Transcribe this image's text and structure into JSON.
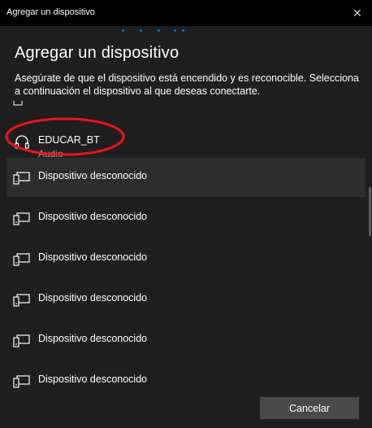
{
  "window": {
    "title": "Agregar un dispositivo",
    "close_glyph": "✕"
  },
  "header": {
    "title": "Agregar un dispositivo",
    "description": "Asegúrate de que el dispositivo está encendido y es reconocible. Selecciona a continuación el dispositivo al que deseas conectarte."
  },
  "devices": [
    {
      "name": "EDUCAR_BT",
      "subtitle": "Audio",
      "icon": "headphones-icon",
      "selected": false,
      "highlighted": true
    },
    {
      "name": "Dispositivo desconocido",
      "icon": "unknown-device-icon",
      "selected": true
    },
    {
      "name": "Dispositivo desconocido",
      "icon": "unknown-device-icon",
      "selected": false
    },
    {
      "name": "Dispositivo desconocido",
      "icon": "unknown-device-icon",
      "selected": false
    },
    {
      "name": "Dispositivo desconocido",
      "icon": "unknown-device-icon",
      "selected": false
    },
    {
      "name": "Dispositivo desconocido",
      "icon": "unknown-device-icon",
      "selected": false
    },
    {
      "name": "Dispositivo desconocido",
      "icon": "unknown-device-icon",
      "selected": false
    }
  ],
  "footer": {
    "cancel_label": "Cancelar"
  },
  "colors": {
    "accent": "#0078d7",
    "highlight_ellipse": "#e8141c",
    "background": "#1f1f1f",
    "selected_row": "#2d2d2d"
  }
}
